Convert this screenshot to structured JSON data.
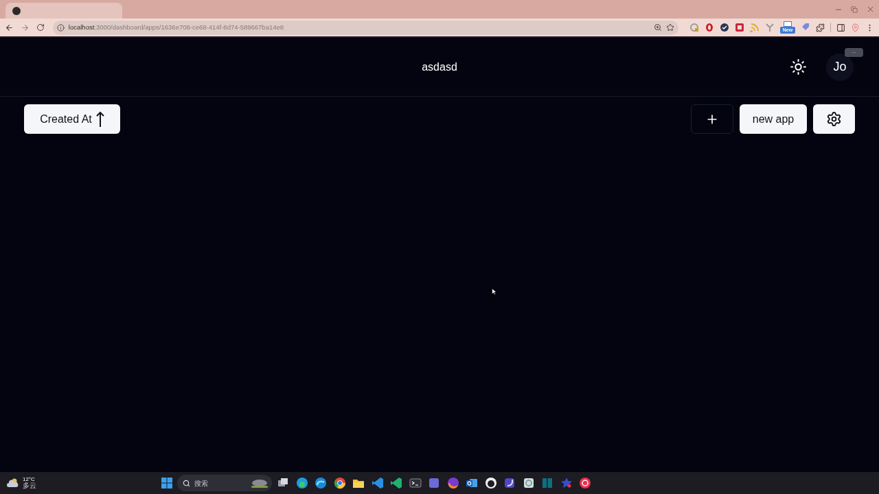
{
  "browser": {
    "address_bar": {
      "host": "localhost",
      "path": ":3000/dashboard/apps/1636e708-ce68-414f-8d74-589667ba14e8"
    },
    "extension_badge": "New"
  },
  "header": {
    "title": "asdasd",
    "avatar": {
      "initials": "Jo",
      "badge": "..."
    }
  },
  "toolbar": {
    "sort_button": {
      "label": "Created At"
    },
    "new_app_button": {
      "label": "new app"
    }
  },
  "taskbar": {
    "weather": {
      "temperature": "12°C",
      "condition": "多云"
    },
    "search": {
      "placeholder": "搜索"
    }
  }
}
